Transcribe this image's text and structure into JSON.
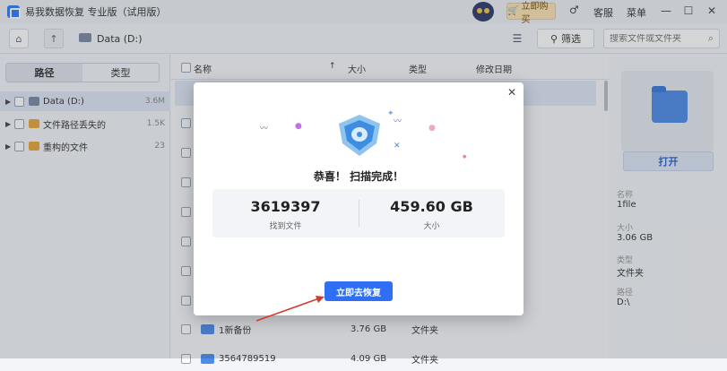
{
  "window": {
    "title": "易我数据恢复 专业版（试用版）",
    "buy_label": "立即购买",
    "support_label": "客服",
    "menu_label": "菜单"
  },
  "toolbar": {
    "breadcrumb": "Data (D:)",
    "filter_label": "筛选",
    "search_placeholder": "搜索文件或文件夹"
  },
  "sidebar": {
    "tabs": [
      {
        "label": "路径"
      },
      {
        "label": "类型"
      }
    ],
    "items": [
      {
        "label": "Data (D:)",
        "count": "3.6M"
      },
      {
        "label": "文件路径丢失的",
        "count": "1.5K"
      },
      {
        "label": "重构的文件",
        "count": "23"
      }
    ]
  },
  "table": {
    "headers": {
      "name": "名称",
      "size": "大小",
      "type": "类型",
      "date": "修改日期"
    },
    "rows": [
      {
        "name": "1新备份",
        "size": "3.76 GB",
        "type": "文件夹"
      },
      {
        "name": "3564789519",
        "size": "4.09 GB",
        "type": "文件夹"
      }
    ]
  },
  "details": {
    "open_label": "打开",
    "name_label": "名称",
    "name_value": "1file",
    "size_label": "大小",
    "size_value": "3.06 GB",
    "type_label": "类型",
    "type_value": "文件夹",
    "path_label": "路径",
    "path_value": "D:\\"
  },
  "dialog": {
    "congrats": "恭喜！ 扫描完成！",
    "files_found_value": "3619397",
    "files_found_label": "找到文件",
    "size_value": "459.60 GB",
    "size_label": "大小",
    "recover_label": "立即去恢复"
  },
  "colors": {
    "accent": "#2f6ff5",
    "folder": "#4d8ce8",
    "buy": "#fbe3b3"
  }
}
